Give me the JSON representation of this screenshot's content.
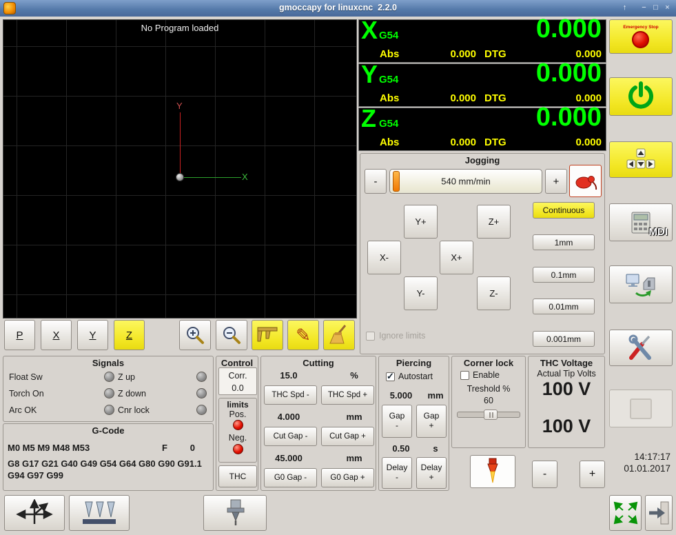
{
  "window": {
    "title": "gmoccapy for linuxcnc  2.2.0",
    "controls": {
      "shade": "↑",
      "minimize": "−",
      "maximize": "□",
      "close": "×"
    }
  },
  "colors": {
    "accent_yellow": "#f2e622",
    "dro_green": "#00ff00",
    "dro_yellow": "#ffff00",
    "led_red": "#e41000",
    "titlebar_blue": "#5378a8"
  },
  "preview": {
    "message": "No Program loaded",
    "y_axis_label": "Y",
    "x_axis_label": "X",
    "toolbar": {
      "p": "P",
      "x": "X",
      "y": "Y",
      "z": "Z"
    }
  },
  "dro": {
    "axes": [
      {
        "letter": "X",
        "system": "G54",
        "value": "0.000",
        "abs_label": "Abs",
        "abs_value": "0.000",
        "dtg_label": "DTG",
        "dtg_value": "0.000"
      },
      {
        "letter": "Y",
        "system": "G54",
        "value": "0.000",
        "abs_label": "Abs",
        "abs_value": "0.000",
        "dtg_label": "DTG",
        "dtg_value": "0.000"
      },
      {
        "letter": "Z",
        "system": "G54",
        "value": "0.000",
        "abs_label": "Abs",
        "abs_value": "0.000",
        "dtg_label": "DTG",
        "dtg_value": "0.000"
      }
    ]
  },
  "jogging": {
    "title": "Jogging",
    "decrease": "-",
    "increase": "+",
    "speed": "540 mm/min",
    "continuous": "Continuous",
    "axis_buttons": [
      "Y+",
      "Z+",
      "X-",
      "X+",
      "Y-",
      "Z-"
    ],
    "increments": [
      "1mm",
      "0.1mm",
      "0.01mm",
      "0.001mm"
    ],
    "ignore_limits": "Ignore limits"
  },
  "signals": {
    "title": "Signals",
    "left": [
      "Float Sw",
      "Torch On",
      "Arc OK"
    ],
    "right": [
      "Z up",
      "Z down",
      "Cnr lock"
    ]
  },
  "gcode": {
    "title": "G-Code",
    "mcodes": "M0 M5 M9 M48 M53",
    "f_label": "F",
    "f_value": "0",
    "gcodes": "G8 G17 G21 G40 G49 G54 G64 G80 G90 G91.1 G94 G97 G99"
  },
  "control": {
    "title": "Control",
    "corr_label": "Corr.",
    "corr_value": "0.0",
    "limits_title": "limits",
    "pos_label": "Pos.",
    "neg_label": "Neg.",
    "thc": "THC"
  },
  "cutting": {
    "title": "Cutting",
    "feed_value": "15.0",
    "feed_unit": "%",
    "thc_spd_minus": "THC Spd -",
    "thc_spd_plus": "THC Spd +",
    "cut_gap_value": "4.000",
    "cut_gap_unit": "mm",
    "cut_gap_minus": "Cut Gap -",
    "cut_gap_plus": "Cut Gap +",
    "g0_gap_value": "45.000",
    "g0_gap_unit": "mm",
    "g0_gap_minus": "G0 Gap -",
    "g0_gap_plus": "G0 Gap +"
  },
  "piercing": {
    "title": "Piercing",
    "autostart": "Autostart",
    "gap_value": "5.000",
    "gap_unit": "mm",
    "gap_minus": "Gap\n-",
    "gap_plus": "Gap\n+",
    "delay_value": "0.50",
    "delay_unit": "s",
    "delay_minus": "Delay\n-",
    "delay_plus": "Delay\n+"
  },
  "corner_lock": {
    "title": "Corner lock",
    "enable": "Enable",
    "threshold_label": "Treshold %",
    "threshold_value": "60"
  },
  "thc_voltage": {
    "title": "THC Voltage",
    "subtitle": "Actual Tip Volts",
    "actual_volts": "100 V",
    "set_volts": "100 V",
    "decrease": "-",
    "increase": "+"
  },
  "sidebar": {
    "estop_label": "Emergency Stop",
    "mdi_label": "MDI",
    "time": "14:17:17",
    "date": "01.01.2017"
  }
}
